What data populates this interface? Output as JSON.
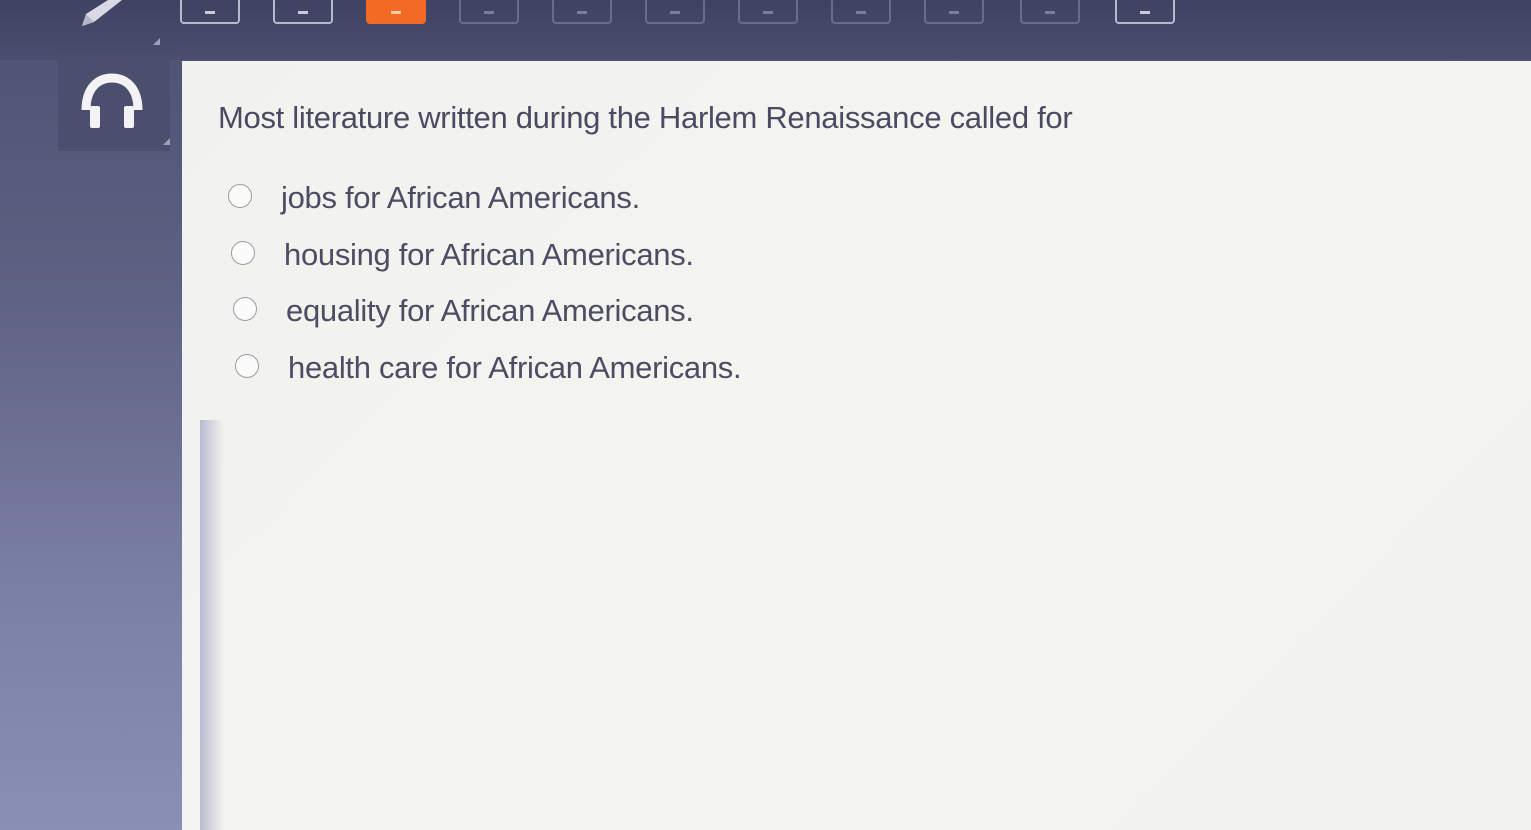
{
  "question": {
    "prompt": "Most literature written during the Harlem Renaissance called for",
    "options": [
      {
        "label": "jobs for African Americans.",
        "selected": false
      },
      {
        "label": "housing for African Americans.",
        "selected": false
      },
      {
        "label": "equality for African Americans.",
        "selected": false
      },
      {
        "label": "health care for African Americans.",
        "selected": false
      }
    ]
  },
  "navigation": {
    "accent_color": "#f26a24"
  },
  "tools": {
    "pencil_icon": "pencil-icon",
    "audio_icon": "headphones-icon"
  }
}
